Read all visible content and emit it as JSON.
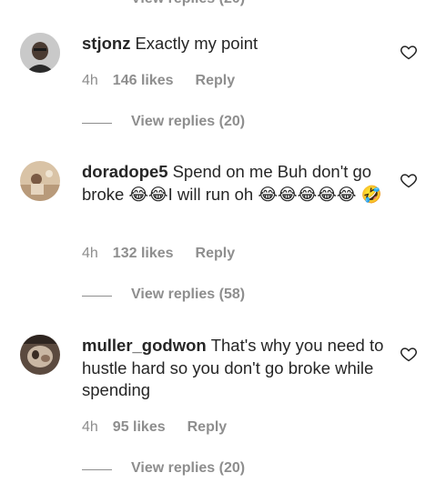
{
  "top_partial": "View replies (20)",
  "comments": [
    {
      "username": "stjonz",
      "text": "Exactly my point",
      "time": "4h",
      "likes": "146 likes",
      "reply": "Reply",
      "replies": "View replies (20)",
      "avatar_icon": "profile-photo"
    },
    {
      "username": "doradope5",
      "text": "Spend on me Buh don't go broke 😂😂I will run oh 😂😂😂😂😂 🤣",
      "time": "4h",
      "likes": "132 likes",
      "reply": "Reply",
      "replies": "View replies (58)",
      "avatar_icon": "profile-photo"
    },
    {
      "username": "muller_godwon",
      "text": "That's why you need to hustle hard so you don't go broke while spending",
      "time": "4h",
      "likes": "95 likes",
      "reply": "Reply",
      "replies": "View replies (20)",
      "avatar_icon": "profile-photo"
    }
  ],
  "icons": {
    "like": "heart-outline-icon"
  },
  "colors": {
    "text": "#262626",
    "muted": "#8e8e8e",
    "background": "#ffffff"
  }
}
